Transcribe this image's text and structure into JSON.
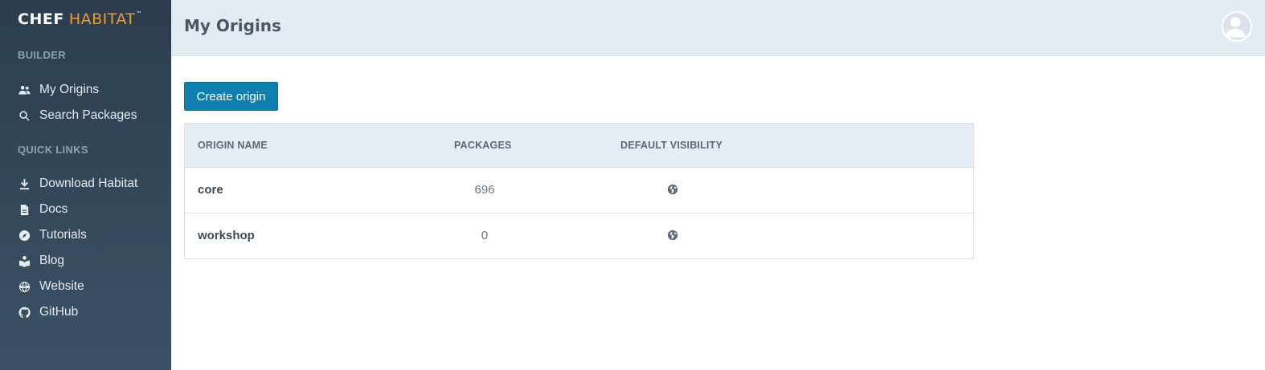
{
  "brand": {
    "primary": "CHEF",
    "secondary": "HABITAT",
    "mark": "™"
  },
  "sidebar": {
    "builder_title": "BUILDER",
    "builder_items": [
      {
        "label": "My Origins",
        "icon": "people-icon"
      },
      {
        "label": "Search Packages",
        "icon": "search-icon"
      }
    ],
    "quick_links_title": "QUICK LINKS",
    "quick_links": [
      {
        "label": "Download Habitat",
        "icon": "download-icon"
      },
      {
        "label": "Docs",
        "icon": "document-icon"
      },
      {
        "label": "Tutorials",
        "icon": "compass-icon"
      },
      {
        "label": "Blog",
        "icon": "book-icon"
      },
      {
        "label": "Website",
        "icon": "globe-icon"
      },
      {
        "label": "GitHub",
        "icon": "github-icon"
      }
    ]
  },
  "header": {
    "title": "My Origins",
    "avatar_icon": "user-avatar-icon"
  },
  "main": {
    "create_button": "Create origin",
    "table": {
      "columns": [
        "ORIGIN NAME",
        "PACKAGES",
        "DEFAULT VISIBILITY"
      ],
      "rows": [
        {
          "name": "core",
          "packages": "696",
          "visibility_icon": "globe-icon"
        },
        {
          "name": "workshop",
          "packages": "0",
          "visibility_icon": "globe-icon"
        }
      ]
    }
  },
  "colors": {
    "sidebar_top": "#2c3e4d",
    "sidebar_bottom": "#3a5166",
    "accent_orange": "#f09a2a",
    "button_blue": "#0e7fb1",
    "header_bg": "#e3ebf3"
  }
}
